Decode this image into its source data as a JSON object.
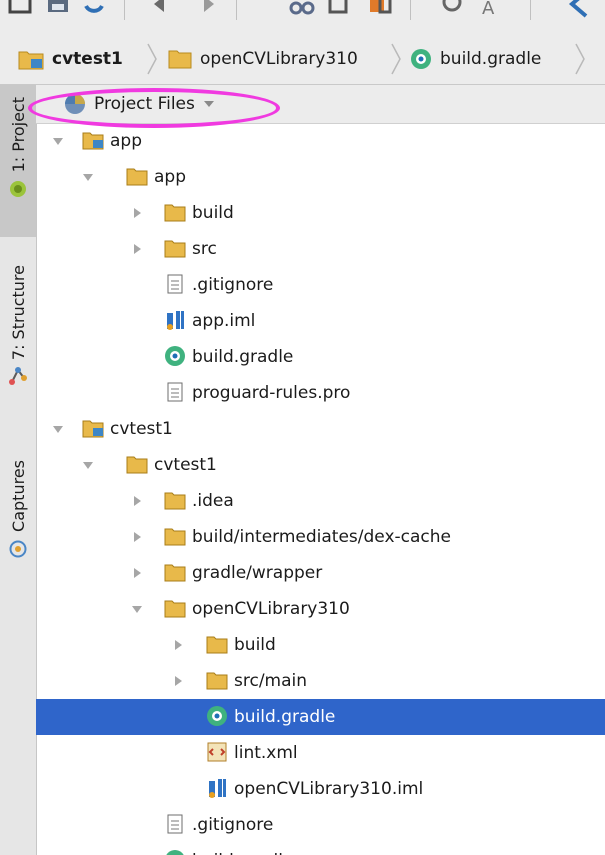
{
  "breadcrumb": {
    "items": [
      {
        "label": "cvtest1"
      },
      {
        "label": "openCVLibrary310"
      },
      {
        "label": "build.gradle"
      }
    ]
  },
  "side_tabs": [
    {
      "label": "1: Project",
      "active": true
    },
    {
      "label": "7: Structure",
      "active": false
    },
    {
      "label": "Captures",
      "active": false
    }
  ],
  "project_view": {
    "selected_view": "Project Files"
  },
  "tree": [
    {
      "label": "app",
      "kind": "module-folder",
      "depth": 0,
      "expanded": true
    },
    {
      "label": "app",
      "kind": "folder",
      "depth": 1,
      "expanded": true
    },
    {
      "label": "build",
      "kind": "folder",
      "depth": 2,
      "expanded": false
    },
    {
      "label": "src",
      "kind": "folder",
      "depth": 2,
      "expanded": false
    },
    {
      "label": ".gitignore",
      "kind": "text-file",
      "depth": 2
    },
    {
      "label": "app.iml",
      "kind": "iml-file",
      "depth": 2
    },
    {
      "label": "build.gradle",
      "kind": "gradle-file",
      "depth": 2
    },
    {
      "label": "proguard-rules.pro",
      "kind": "text-file",
      "depth": 2
    },
    {
      "label": "cvtest1",
      "kind": "module-folder",
      "depth": 0,
      "expanded": true
    },
    {
      "label": "cvtest1",
      "kind": "folder",
      "depth": 1,
      "expanded": true
    },
    {
      "label": ".idea",
      "kind": "folder",
      "depth": 2,
      "expanded": false
    },
    {
      "label": "build/intermediates/dex-cache",
      "kind": "folder",
      "depth": 2,
      "expanded": false
    },
    {
      "label": "gradle/wrapper",
      "kind": "folder",
      "depth": 2,
      "expanded": false
    },
    {
      "label": "openCVLibrary310",
      "kind": "folder",
      "depth": 2,
      "expanded": true
    },
    {
      "label": "build",
      "kind": "folder",
      "depth": 3,
      "expanded": false
    },
    {
      "label": "src/main",
      "kind": "folder",
      "depth": 3,
      "expanded": false
    },
    {
      "label": "build.gradle",
      "kind": "gradle-file",
      "depth": 3,
      "selected": true
    },
    {
      "label": "lint.xml",
      "kind": "xml-file",
      "depth": 3
    },
    {
      "label": "openCVLibrary310.iml",
      "kind": "iml-file",
      "depth": 3
    },
    {
      "label": ".gitignore",
      "kind": "text-file",
      "depth": 2
    },
    {
      "label": "build.gradle",
      "kind": "gradle-file",
      "depth": 2
    }
  ],
  "colors": {
    "selection": "#2f65ca",
    "highlight_ellipse": "#f03ae0",
    "folder": "#e8b94a",
    "gradle": "#3fb27f"
  }
}
